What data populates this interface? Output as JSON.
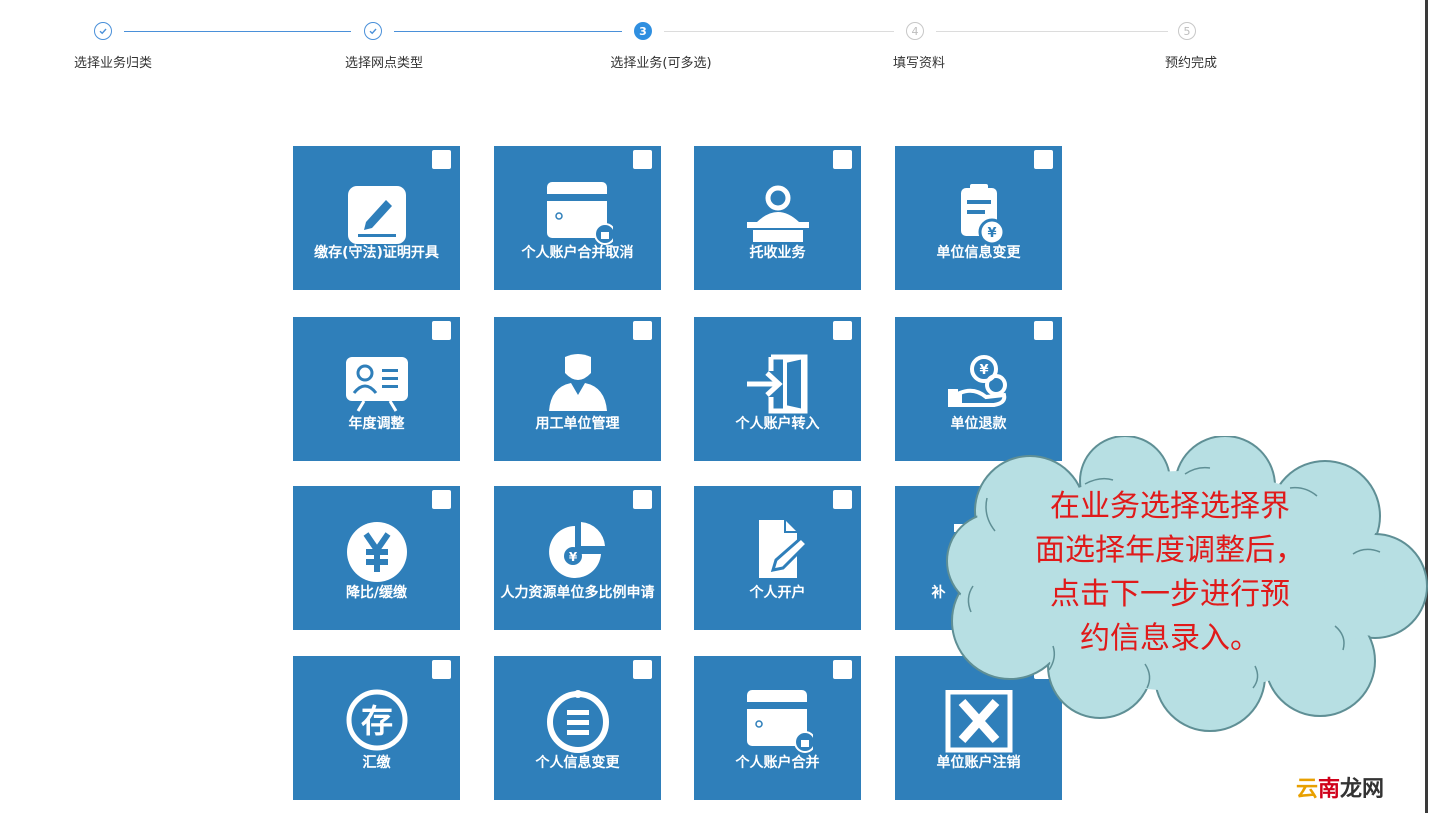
{
  "steps": [
    {
      "label": "选择业务归类",
      "state": "done",
      "marker": ""
    },
    {
      "label": "选择网点类型",
      "state": "done",
      "marker": ""
    },
    {
      "label": "选择业务(可多选)",
      "state": "active",
      "marker": "3"
    },
    {
      "label": "填写资料",
      "state": "todo",
      "marker": "4"
    },
    {
      "label": "预约完成",
      "state": "todo",
      "marker": "5"
    }
  ],
  "tiles": [
    {
      "label": "缴存(守法)证明开具",
      "icon": "certificate-pen-icon",
      "checked": false
    },
    {
      "label": "个人账户合并取消",
      "icon": "card-lock-icon",
      "checked": false
    },
    {
      "label": "托收业务",
      "icon": "teller-desk-icon",
      "checked": false
    },
    {
      "label": "单位信息变更",
      "icon": "clipboard-yuan-icon",
      "checked": false
    },
    {
      "label": "年度调整",
      "icon": "id-card-icon",
      "checked": false
    },
    {
      "label": "用工单位管理",
      "icon": "person-bust-icon",
      "checked": false
    },
    {
      "label": "个人账户转入",
      "icon": "door-enter-icon",
      "checked": false
    },
    {
      "label": "单位退款",
      "icon": "hand-coins-icon",
      "checked": false
    },
    {
      "label": "降比/缓缴",
      "icon": "yuan-circle-icon",
      "checked": false
    },
    {
      "label": "人力资源单位多比例申请",
      "icon": "pie-yuan-icon",
      "checked": false
    },
    {
      "label": "个人开户",
      "icon": "document-pen-icon",
      "checked": false
    },
    {
      "label": "补",
      "icon": "t-shape-icon",
      "checked": false
    },
    {
      "label": "汇缴",
      "icon": "deposit-stamp-icon",
      "checked": false
    },
    {
      "label": "个人信息变更",
      "icon": "tag-list-icon",
      "checked": false
    },
    {
      "label": "个人账户合并",
      "icon": "card-lock-icon",
      "checked": false
    },
    {
      "label": "单位账户注销",
      "icon": "x-box-icon",
      "checked": false
    }
  ],
  "callout": {
    "text": "在业务选择选择界\n面选择年度调整后，\n点击下一步进行预\n约信息录入。"
  },
  "watermark": {
    "part1": "云",
    "part2": "南",
    "part3": "龙网"
  },
  "colors": {
    "tile": "#2f7fba",
    "step_done": "#4a90d9",
    "step_active": "#2f8fe0",
    "callout_fill": "#b7dfe3",
    "callout_text": "#e01a1a"
  }
}
